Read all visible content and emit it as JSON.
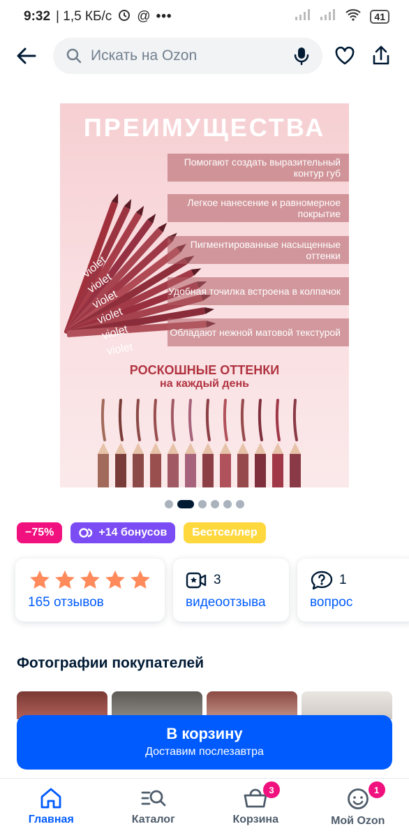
{
  "status_bar": {
    "time": "9:32",
    "speed": "| 1,5 КБ/с",
    "battery": "41"
  },
  "header": {
    "search_placeholder": "Искать на Ozon"
  },
  "promo_image": {
    "title": "ПРЕИМУЩЕСТВА",
    "features": [
      "Помогают создать выразительный контур губ",
      "Легкое нанесение и равномерное покрытие",
      "Пигментированные насыщенные оттенки",
      "Удобная точилка встроена в колпачок",
      "Обладают нежной матовой текстурой"
    ],
    "subtitle_1": "РОСКОШНЫЕ ОТТЕНКИ",
    "subtitle_2": "на каждый день",
    "brand": "violet",
    "swatch_colors": [
      "#a26a5a",
      "#7a3c38",
      "#8b4a47",
      "#9a4f4f",
      "#a15a63",
      "#a7637b",
      "#8c3f45",
      "#b0525b",
      "#964a4c",
      "#7e2f3b",
      "#a03848",
      "#8a3a46"
    ],
    "slide_count": 6,
    "active_slide": 2
  },
  "badges": {
    "discount": "−75%",
    "bonus": "+14 бонусов",
    "bestseller": "Бестселлер",
    "colors": {
      "discount": "#f1117e",
      "bonus": "#7b4cf4",
      "bestseller": "#ffd83d"
    }
  },
  "stats": {
    "rating_stars": 5,
    "reviews_link": "165 отзывов",
    "video_count": "3",
    "video_link": "видеоотзыва",
    "question_count": "1",
    "question_link": "вопрос"
  },
  "customer_photos": {
    "title": "Фотографии покупателей"
  },
  "cta": {
    "label": "В корзину",
    "sublabel": "Доставим послезавтра",
    "color": "#005bff"
  },
  "bottom_nav": {
    "home": "Главная",
    "catalog": "Каталог",
    "cart": "Корзина",
    "cart_badge": "3",
    "account": "Мой Ozon",
    "account_badge": "1"
  }
}
